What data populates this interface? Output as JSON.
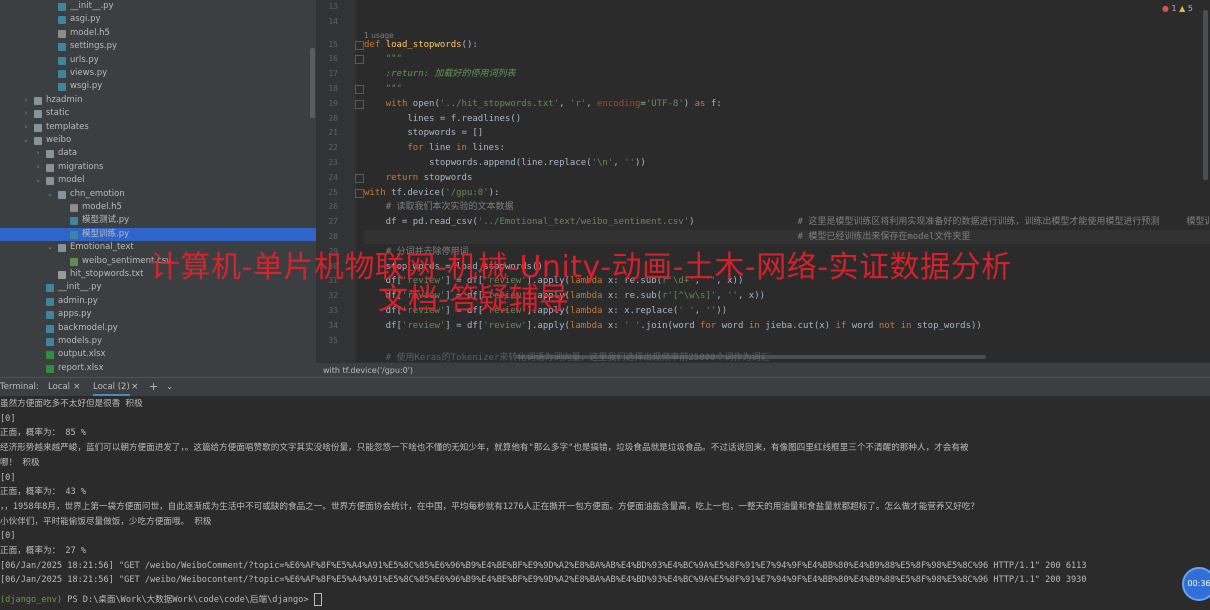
{
  "project_tree": [
    {
      "label": "__init__.py",
      "indent": 5,
      "icon": "python-file-icon",
      "arrow": ""
    },
    {
      "label": "asgi.py",
      "indent": 5,
      "icon": "python-file-icon",
      "arrow": ""
    },
    {
      "label": "model.h5",
      "indent": 5,
      "icon": "file-icon",
      "arrow": ""
    },
    {
      "label": "settings.py",
      "indent": 5,
      "icon": "python-file-icon",
      "arrow": ""
    },
    {
      "label": "urls.py",
      "indent": 5,
      "icon": "python-file-icon",
      "arrow": ""
    },
    {
      "label": "views.py",
      "indent": 5,
      "icon": "python-file-icon",
      "arrow": ""
    },
    {
      "label": "wsgi.py",
      "indent": 5,
      "icon": "python-file-icon",
      "arrow": ""
    },
    {
      "label": "hzadmin",
      "indent": 3,
      "icon": "folder-icon",
      "arrow": "›"
    },
    {
      "label": "static",
      "indent": 3,
      "icon": "folder-icon",
      "arrow": "›"
    },
    {
      "label": "templates",
      "indent": 3,
      "icon": "folder-icon",
      "arrow": "›"
    },
    {
      "label": "weibo",
      "indent": 3,
      "icon": "folder-icon",
      "arrow": "⌄"
    },
    {
      "label": "data",
      "indent": 4,
      "icon": "folder-icon",
      "arrow": "›"
    },
    {
      "label": "migrations",
      "indent": 4,
      "icon": "folder-icon",
      "arrow": "›"
    },
    {
      "label": "model",
      "indent": 4,
      "icon": "folder-icon",
      "arrow": "⌄"
    },
    {
      "label": "chn_emotion",
      "indent": 5,
      "icon": "folder-icon",
      "arrow": "⌄"
    },
    {
      "label": "model.h5",
      "indent": 6,
      "icon": "file-icon",
      "arrow": ""
    },
    {
      "label": "模型测试.py",
      "indent": 6,
      "icon": "python-file-icon",
      "arrow": ""
    },
    {
      "label": "模型训练.py",
      "indent": 6,
      "icon": "python-file-icon",
      "arrow": "",
      "selected": true
    },
    {
      "label": "Emotional_text",
      "indent": 5,
      "icon": "folder-icon",
      "arrow": "⌄"
    },
    {
      "label": "weibo_sentiment.csv",
      "indent": 6,
      "icon": "csv-file-icon",
      "arrow": ""
    },
    {
      "label": "hit_stopwords.txt",
      "indent": 5,
      "icon": "text-file-icon",
      "arrow": ""
    },
    {
      "label": "__init__.py",
      "indent": 4,
      "icon": "python-file-icon",
      "arrow": ""
    },
    {
      "label": "admin.py",
      "indent": 4,
      "icon": "python-file-icon",
      "arrow": ""
    },
    {
      "label": "apps.py",
      "indent": 4,
      "icon": "python-file-icon",
      "arrow": ""
    },
    {
      "label": "backmodel.py",
      "indent": 4,
      "icon": "python-file-icon",
      "arrow": ""
    },
    {
      "label": "models.py",
      "indent": 4,
      "icon": "python-file-icon",
      "arrow": ""
    },
    {
      "label": "output.xlsx",
      "indent": 4,
      "icon": "excel-file-icon",
      "arrow": ""
    },
    {
      "label": "report.xlsx",
      "indent": 4,
      "icon": "excel-file-icon",
      "arrow": ""
    }
  ],
  "editor": {
    "line_numbers": [
      "13",
      "14",
      "15",
      "16",
      "17",
      "18",
      "19",
      "20",
      "21",
      "22",
      "23",
      "24",
      "25",
      "26",
      "27",
      "28",
      "29",
      "30",
      "31",
      "32",
      "33",
      "34",
      "35"
    ],
    "usage_hint": "1 usage",
    "inspection": {
      "errors": "1",
      "warnings": "5"
    },
    "lines": [
      {
        "n": "13",
        "html": ""
      },
      {
        "n": "14",
        "html": ""
      },
      {
        "n": "15",
        "html": "<span class='kw'>def </span><span class='fn'>load_stopwords</span>():"
      },
      {
        "n": "16",
        "html": "    <span class='doc'>\"\"\"</span>"
      },
      {
        "n": "17",
        "html": "    <span class='doc'>:return: 加载好的停用词列表</span>"
      },
      {
        "n": "18",
        "html": "    <span class='doc'>\"\"\"</span>"
      },
      {
        "n": "19",
        "html": "    <span class='kw'>with </span>open(<span class='st'>'../hit_stopwords.txt'</span>, <span class='st'>'r'</span>, <span class='pm'>encoding</span>=<span class='st'>'UTF-8'</span>) <span class='kw'>as </span>f:"
      },
      {
        "n": "20",
        "html": "        lines = f.readlines()"
      },
      {
        "n": "21",
        "html": "        stopwords = []"
      },
      {
        "n": "22",
        "html": "        <span class='kw'>for </span>line <span class='kw'>in </span>lines:"
      },
      {
        "n": "23",
        "html": "            stopwords.append(line.replace(<span class='st'>'\\n'</span>, <span class='st'>''</span>))"
      },
      {
        "n": "24",
        "html": "    <span class='kw'>return </span>stopwords"
      },
      {
        "n": "25",
        "html": "<span class='kw'>with </span>tf.device(<span class='st'>'/gpu:0'</span>):"
      },
      {
        "n": "26",
        "html": "    <span class='cm'># 读取我们本次实验的文本数据</span>"
      },
      {
        "n": "27",
        "html": "    df = pd.read_csv(<span class='st'>'../Emotional_text/weibo_sentiment.csv'</span>)                   <span class='cm'># 这里是模型训练区将利用实现准备好的数据进行训练，训练出模型才能使用模型进行预测     模型训练的时间会</span>"
      },
      {
        "n": "28",
        "html": "                                                                                <span class='cm'># 模型已经训练出来保存在model文件夹里</span>"
      },
      {
        "n": "29",
        "html": "    <span class='cm'># 分词并去除停用词</span>"
      },
      {
        "n": "30",
        "html": "    stop_words = load_stopwords()"
      },
      {
        "n": "31",
        "html": "    df[<span class='st'>'review'</span>] = df[<span class='st'>'review'</span>].apply(<span class='kw'>lambda </span>x: re.sub(<span class='st'>r'\\d+'</span>, <span class='st'>''</span>, x))"
      },
      {
        "n": "32",
        "html": "    df[<span class='st'>'review'</span>] = df[<span class='st'>'review'</span>].apply(<span class='kw'>lambda </span>x: re.sub(<span class='st'>r'[^\\w\\s]'</span>, <span class='st'>''</span>, x))"
      },
      {
        "n": "33",
        "html": "    df[<span class='st'>'review'</span>] = df[<span class='st'>'review'</span>].apply(<span class='kw'>lambda </span>x: x.replace(<span class='st'>' '</span>, <span class='st'>''</span>))"
      },
      {
        "n": "34",
        "html": "    df[<span class='st'>'review'</span>] = df[<span class='st'>'review'</span>].apply(<span class='kw'>lambda </span>x: <span class='st'>' '</span>.join(word <span class='kw'>for </span>word <span class='kw'>in </span>jieba.cut(x) <span class='kw'>if </span>word <span class='kw'>not in </span>stop_words))"
      },
      {
        "n": "35",
        "html": ""
      }
    ],
    "partial_line": "    # 使用Keras的Tokenizer来转化词语为词向量，这里我们选择出现频率前25000个词作为词汇",
    "breadcrumb": "with tf.device('/gpu:0')"
  },
  "terminal_tabs": {
    "title": "Terminal:",
    "tab1": "Local",
    "tab2": "Local (2)",
    "close": "×",
    "add": "+",
    "more": "⌄"
  },
  "terminal_lines": [
    "虽然方便面吃多不太好但是很香 积极",
    "[0]",
    "正面，概率为： 85 %",
    "经济形势越来越严峻，蓝们可以朝方便面进发了，。这篇给方便面唱赞歌的文字其实没啥份量，只能忽悠一下啥也不懂的无知少年，就算他有\"那么多字\"也是搞错，垃圾食品就是垃圾食品。不过话说回来，有像图四里红线框里三个不清醒的那种人，才会有被",
    "哪！ 积极",
    "[0]",
    "正面，概率为： 43 %",
    "，，1958年8月，世界上第一袋方便面问世，自此逐渐成为生活中不可或缺的食品之一。世界方便面协会统计，在中国，平均每秒就有1276人正在撕开一包方便面。方便面油盐含量高，吃上一包，一整天的用油量和食盐量就都超标了。怎么做才能营养又好吃？",
    "小伙伴们，平时能偷饭尽量做饭，少吃方便面哦。 积极",
    "[0]",
    "正面，概率为： 27 %",
    "[06/Jan/2025 18:21:56] \"GET /weibo/WeiboComment/?topic=%E6%AF%8F%E5%A4%A91%E5%8C%85%E6%96%B9%E4%BE%BF%E9%9D%A2%E8%BA%AB%E4%BD%93%E4%BC%9A%E5%8F%91%E7%94%9F%E4%BB%80%E4%B9%88%E5%8F%98%E5%8C%96 HTTP/1.1\" 200 6113",
    "[06/Jan/2025 18:21:56] \"GET /weibo/Weibocontent/?topic=%E6%AF%8F%E5%A4%A91%E5%8C%85%E6%96%B9%E4%BE%BF%E9%9D%A2%E8%BA%AB%E4%BD%93%E4%BC%9A%E5%8F%91%E7%94%9F%E4%BB%80%E4%B9%88%E5%8F%98%E5%8C%96 HTTP/1.1\" 200 3930"
  ],
  "prompt": {
    "env": "(django_env)",
    "path": " PS D:\\桌面\\Work\\大数据Work\\code\\code\\后端\\django> "
  },
  "timer": "00:36",
  "watermark": {
    "line1": "计算机-单片机物联网-机械-Unity-动画-土木-网络-实证数据分析",
    "line2": "文档-答疑辅导"
  },
  "icon_colors": {
    "folder-icon": "#87939a",
    "python-file-icon": "#3e86a0",
    "file-icon": "#8c8c8c",
    "csv-file-icon": "#5b8f4a",
    "text-file-icon": "#9a9a9a",
    "excel-file-icon": "#2f8f3e"
  }
}
